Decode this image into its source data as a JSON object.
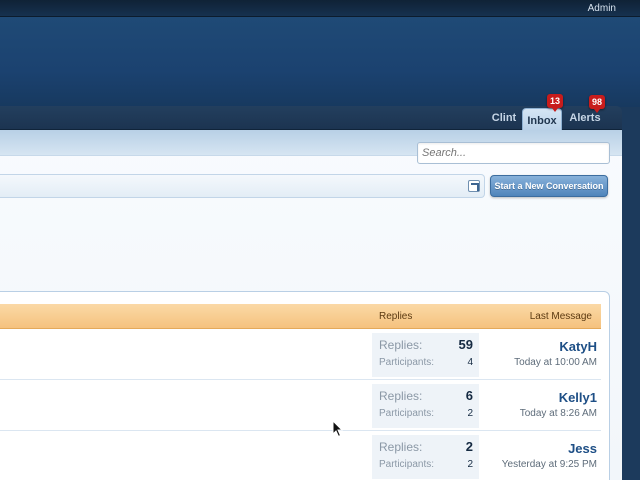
{
  "topbar": {
    "admin_label": "Admin"
  },
  "nav": {
    "tabs": [
      {
        "label": "Clint"
      },
      {
        "label": "Inbox",
        "badge": "13",
        "active": true
      },
      {
        "label": "Alerts",
        "badge": "98"
      }
    ]
  },
  "search": {
    "placeholder": "Search..."
  },
  "actions": {
    "new_conversation_label": "Start a New Conversation"
  },
  "list": {
    "columns": {
      "replies": "Replies",
      "last_message": "Last Message"
    },
    "rows": [
      {
        "replies_label": "Replies:",
        "replies": "59",
        "participants_label": "Participants:",
        "participants": "4",
        "last_user": "KatyH",
        "last_time": "Today at 10:00 AM"
      },
      {
        "replies_label": "Replies:",
        "replies": "6",
        "participants_label": "Participants:",
        "participants": "2",
        "last_user": "Kelly1",
        "last_time": "Today at 8:26 AM"
      },
      {
        "replies_label": "Replies:",
        "replies": "2",
        "participants_label": "Participants:",
        "participants": "2",
        "last_user": "Jess",
        "last_time": "Yesterday at 9:25 PM"
      }
    ]
  },
  "colors": {
    "header_blue": "#1b4270",
    "list_header_orange": "#f5c27e",
    "badge_red": "#c81c1c",
    "username_blue": "#1e4f86"
  },
  "icons": {
    "cursor": "mouse-pointer-icon",
    "jump": "external-jump-icon"
  }
}
